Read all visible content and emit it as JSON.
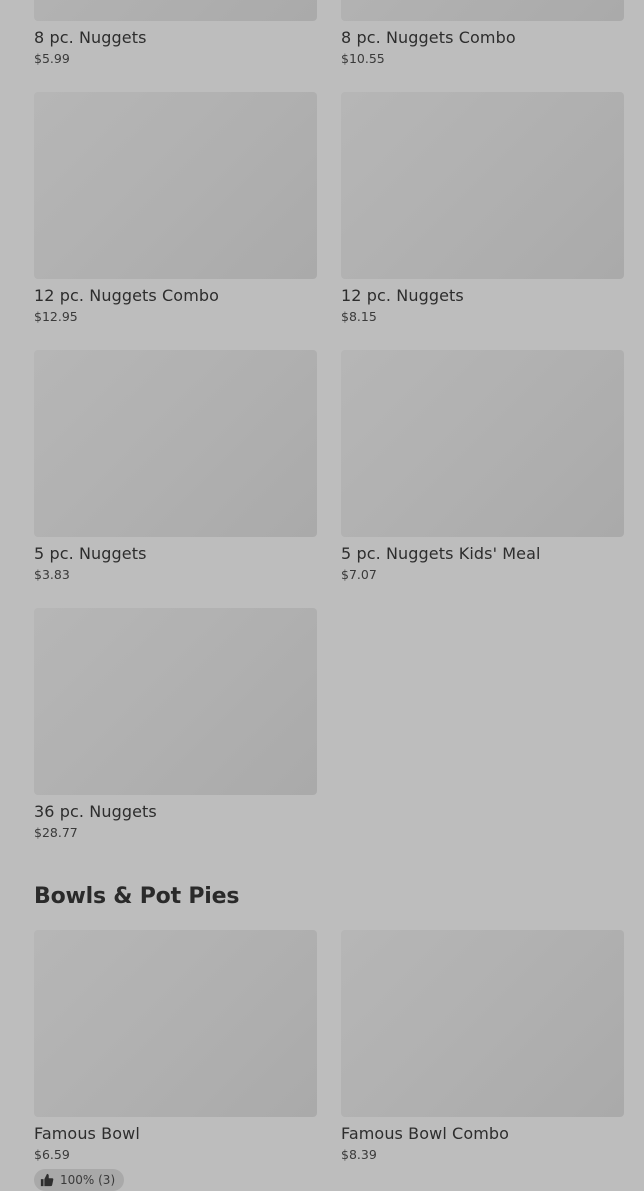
{
  "sections": [
    {
      "items": [
        {
          "name": "8 pc. Nuggets",
          "price": "$5.99"
        },
        {
          "name": "8 pc. Nuggets Combo",
          "price": "$10.55"
        },
        {
          "name": "12 pc. Nuggets Combo",
          "price": "$12.95"
        },
        {
          "name": "12 pc. Nuggets",
          "price": "$8.15"
        },
        {
          "name": "5 pc. Nuggets",
          "price": "$3.83"
        },
        {
          "name": "5 pc. Nuggets Kids' Meal",
          "price": "$7.07"
        },
        {
          "name": "36 pc. Nuggets",
          "price": "$28.77"
        }
      ]
    },
    {
      "title": "Bowls & Pot Pies",
      "items": [
        {
          "name": "Famous Bowl",
          "price": "$6.59",
          "rating": "100% (3)",
          "rating_icon": "thumbs-up-icon"
        },
        {
          "name": "Famous Bowl Combo",
          "price": "$8.39"
        }
      ]
    }
  ]
}
